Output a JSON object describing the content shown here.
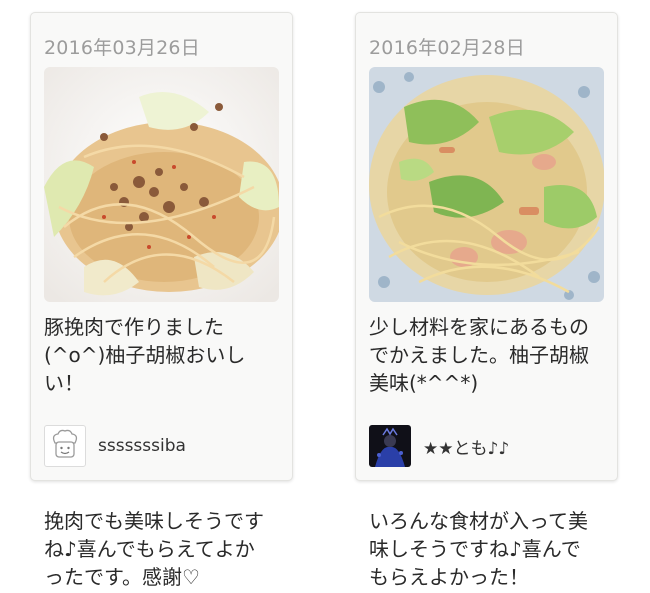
{
  "reports": [
    {
      "date": "2016年03月26日",
      "photo_icon": "pasta-photo",
      "comment": "豚挽肉で作りました\n(^o^)柚子胡椒おいし\nい！",
      "author": {
        "avatar_icon": "chef-avatar-icon",
        "name": "sssssssiba"
      },
      "reply": "挽肉でも美味しそうです\nね♪喜んでもらえてよか\nったです。感謝♡"
    },
    {
      "date": "2016年02月28日",
      "photo_icon": "pasta-photo",
      "comment": "少し材料を家にあるもの\nでかえました。柚子胡椒\n美味(*^^*)",
      "author": {
        "avatar_icon": "user-photo-avatar",
        "name": "★★とも♪♪"
      },
      "reply": "いろんな食材が入って美\n味しそうですね♪喜んで\nもらえよかった！"
    }
  ]
}
